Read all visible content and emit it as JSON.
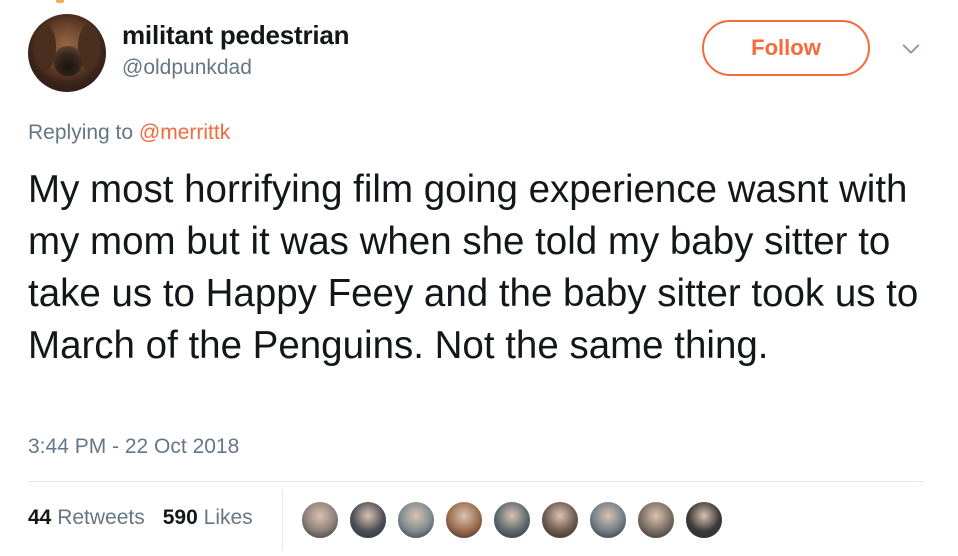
{
  "user": {
    "name": "militant pedestrian",
    "handle": "@oldpunkdad"
  },
  "follow_label": "Follow",
  "reply": {
    "prefix": "Replying to ",
    "mention": "@merrittk"
  },
  "tweet": {
    "text": "My most horrifying film going experience wasnt with my mom but it was when she told my baby sitter to take us to Happy Feey and the baby sitter took us to March of the Penguins. Not the same thing.",
    "timestamp": "3:44 PM - 22 Oct 2018"
  },
  "stats": {
    "retweets_count": "44",
    "retweets_label": "Retweets",
    "likes_count": "590",
    "likes_label": "Likes"
  },
  "colors": {
    "accent": "#f56a3a",
    "secondary_text": "#657786",
    "primary_text": "#14171a"
  },
  "liker_avatar_colors": [
    "#8a7f78",
    "#4b4f55",
    "#7d8b8e",
    "#9b6a4c",
    "#5c6a6e",
    "#6b5a4f",
    "#6f7d88",
    "#7a6c64",
    "#3a3a3a"
  ]
}
